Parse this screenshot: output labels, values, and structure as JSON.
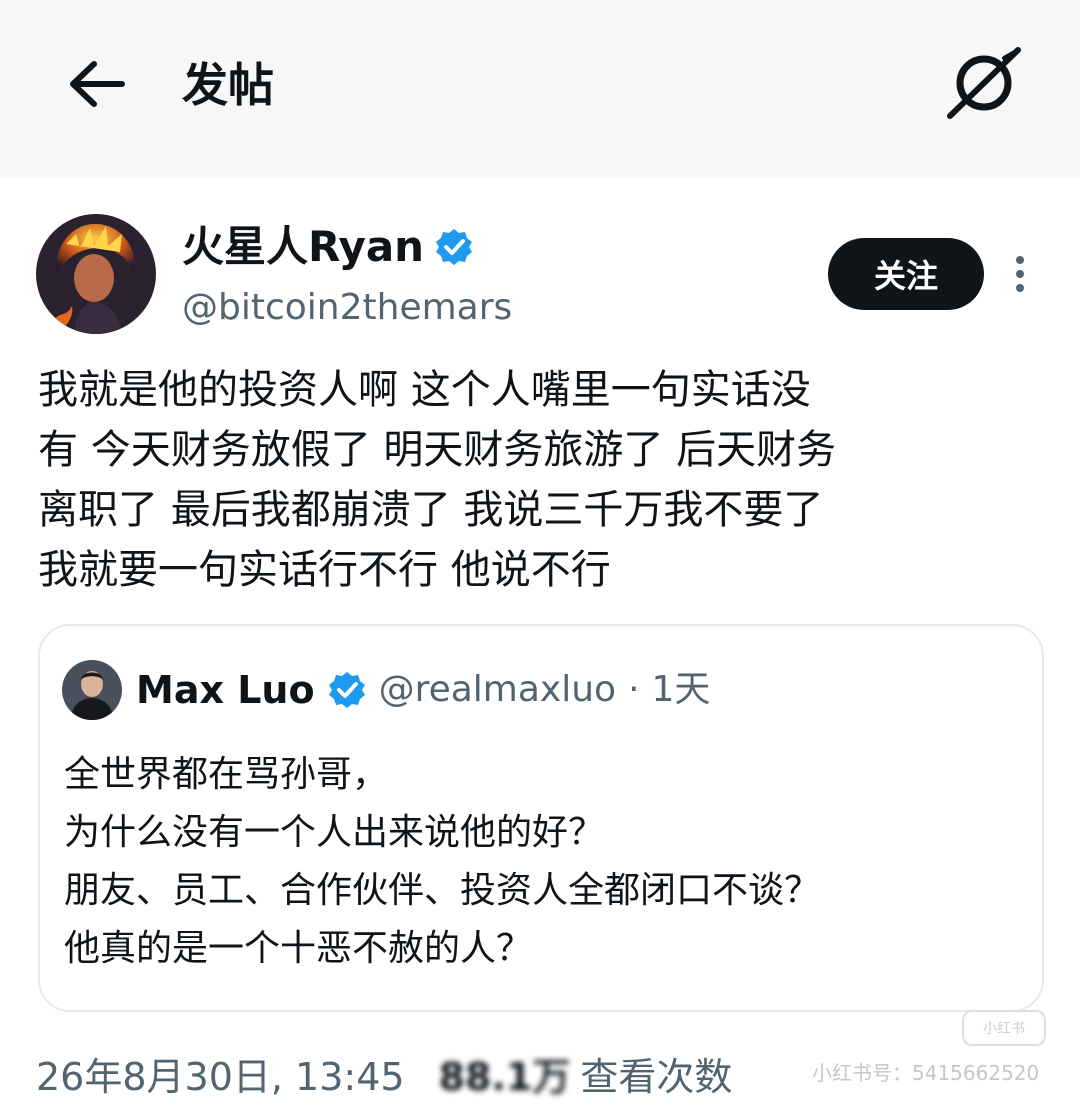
{
  "header": {
    "title": "发帖"
  },
  "post": {
    "author_name": "火星人Ryan",
    "handle": "@bitcoin2themars",
    "follow_label": "关注",
    "body_lines": [
      "我就是他的投资人啊 这个人嘴里一句实话没",
      "有 今天财务放假了 明天财务旅游了 后天财务",
      "离职了 最后我都崩溃了 我说三千万我不要了",
      "我就要一句实话行不行 他说不行"
    ],
    "timestamp": "26年8月30日, 13:45",
    "views_count": "88.1万",
    "views_label": "查看次数"
  },
  "quote": {
    "author_name": "Max Luo",
    "handle": "@realmaxluo",
    "separator": "·",
    "time": "1天",
    "body_lines": [
      "全世界都在骂孙哥，",
      "为什么没有一个人出来说他的好？",
      "朋友、员工、合作伙伴、投资人全都闭口不谈？",
      "他真的是一个十恶不赦的人？"
    ]
  },
  "watermark": {
    "text": "小红书号：5415662520",
    "stamp": "小红书"
  },
  "icons": {
    "back": "arrow-left-icon",
    "brand": "grok-icon",
    "verified": "verified-badge-icon",
    "more": "more-vertical-icon"
  },
  "colors": {
    "verified": "#1d9bf0",
    "secondary_text": "#536471",
    "primary_text": "#0f1419",
    "follow_button": "#0f1419",
    "header_bg": "#f7f7f7"
  }
}
